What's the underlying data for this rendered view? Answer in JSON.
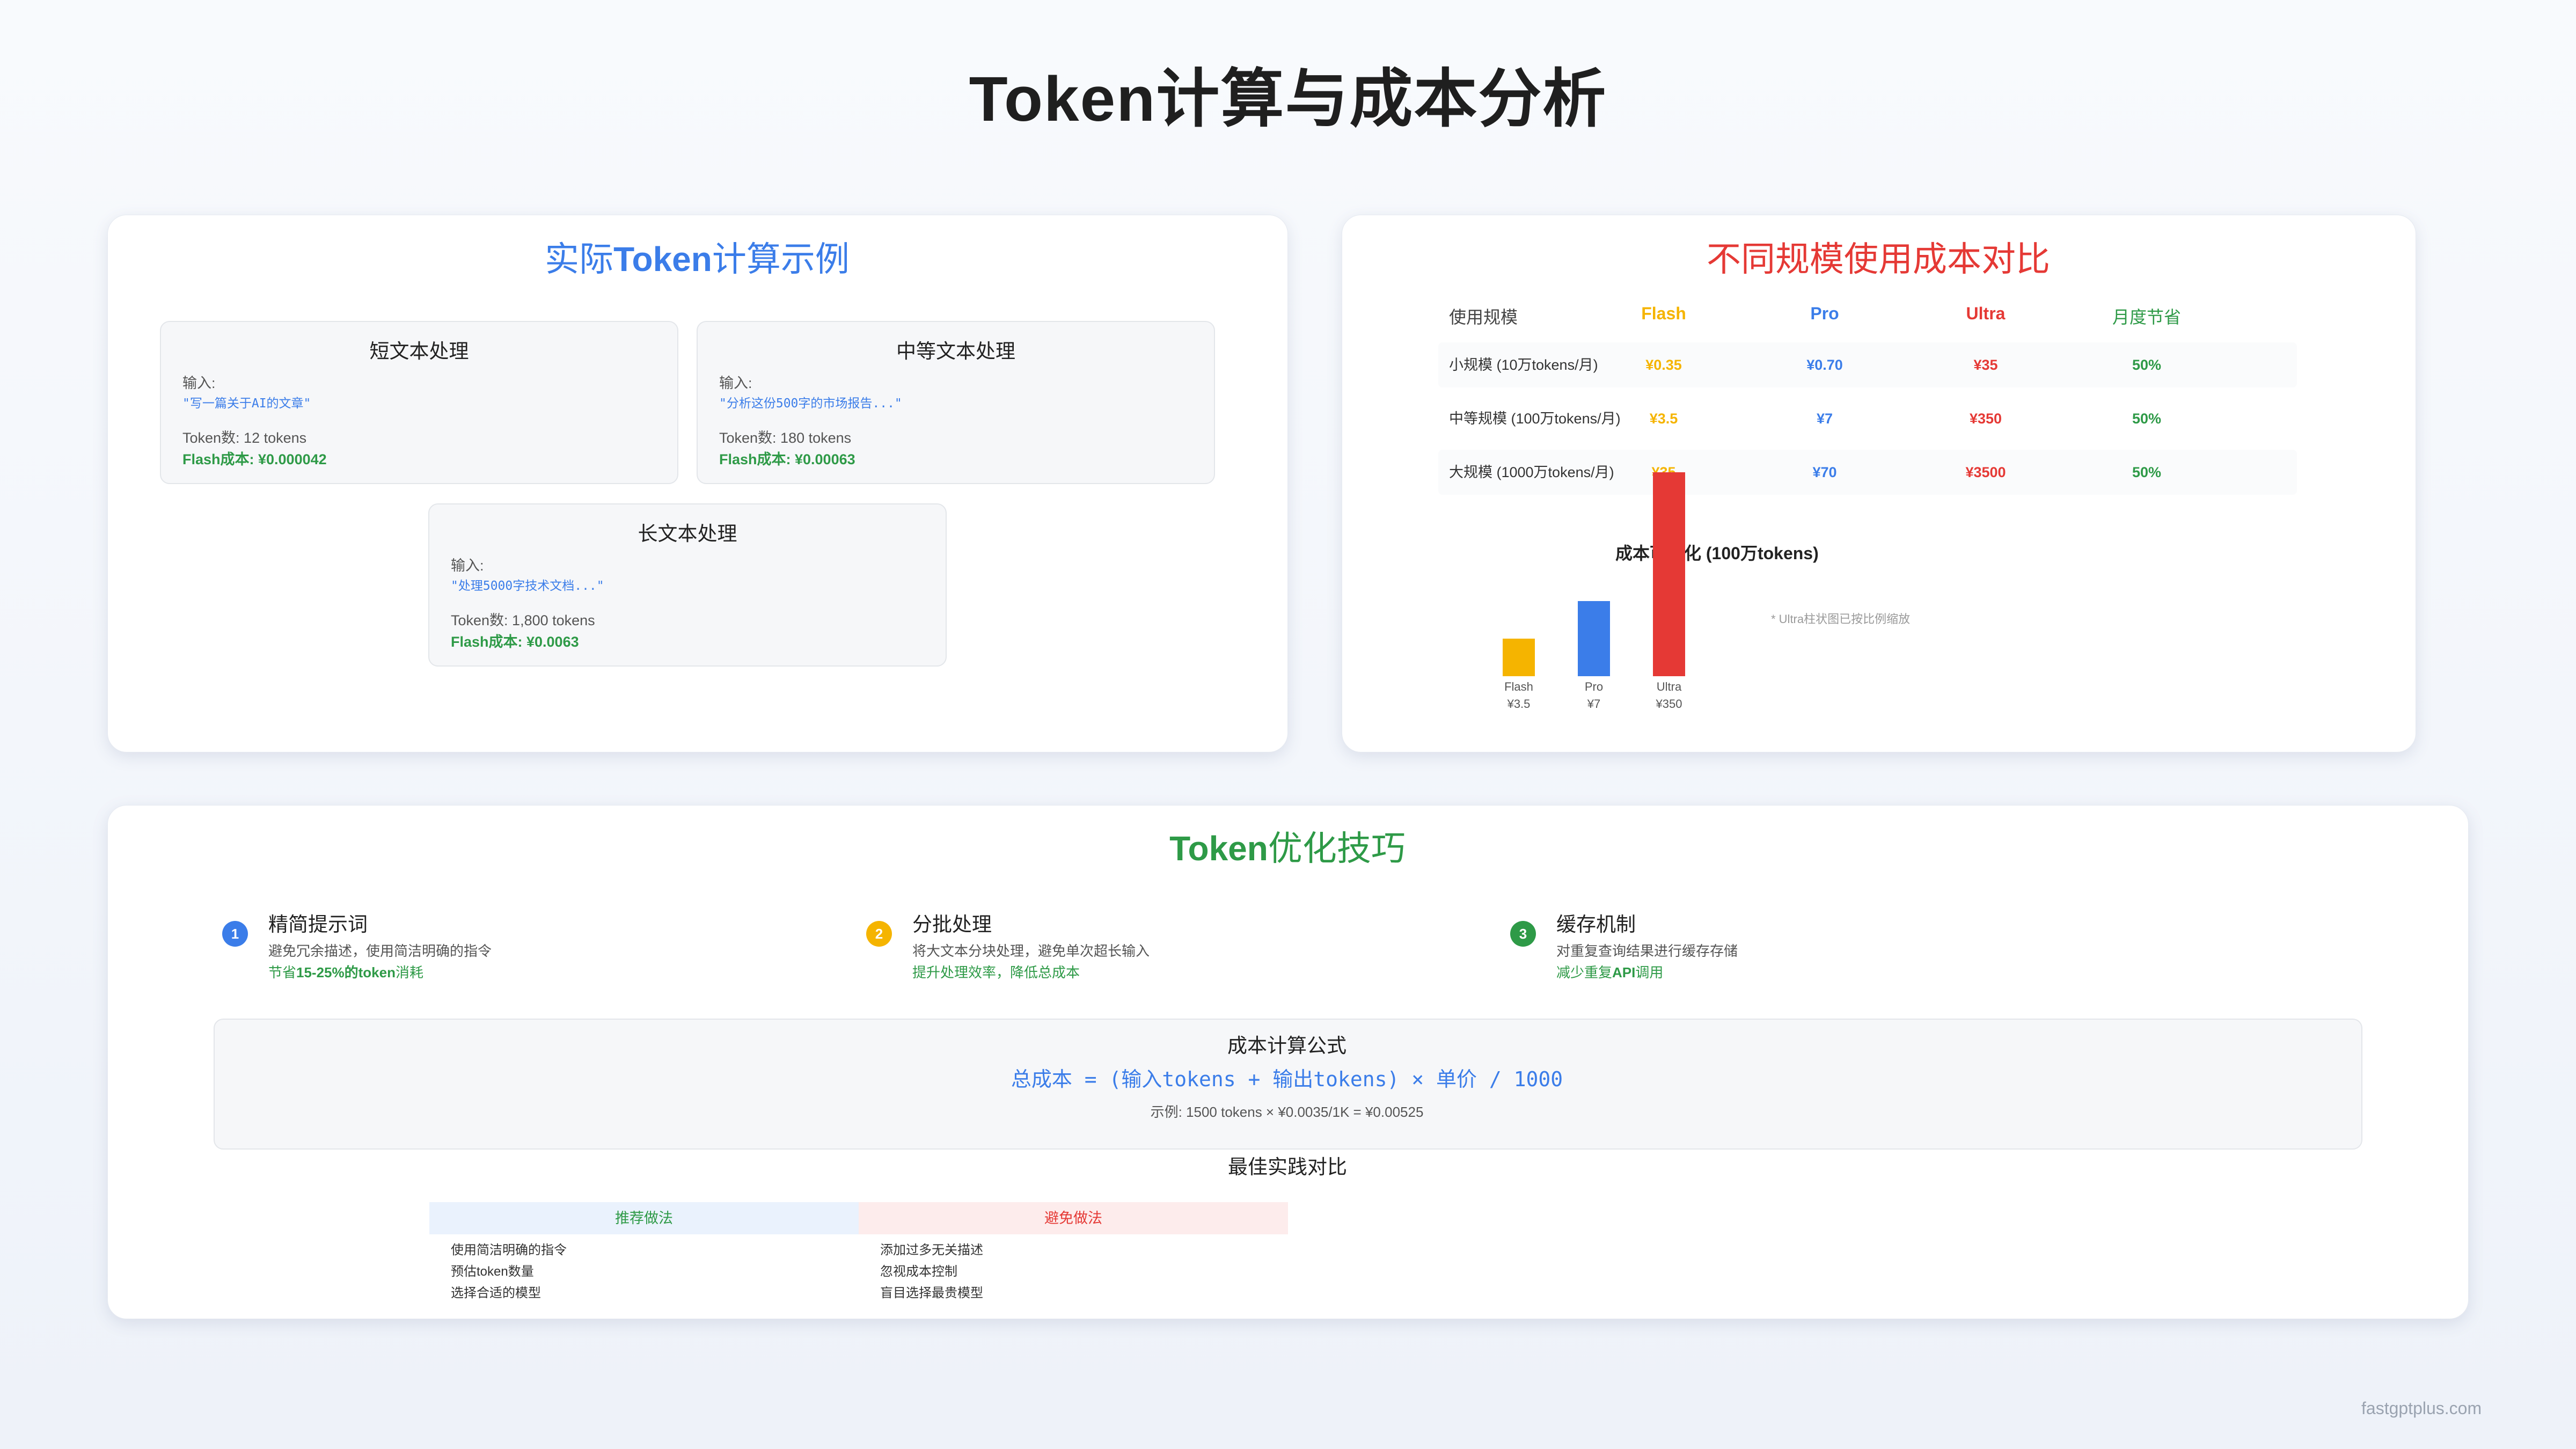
{
  "page_title": "Token计算与成本分析",
  "examples_card": {
    "title_prefix": "实际",
    "title_highlight": "Token",
    "title_suffix": "计算示例",
    "examples": [
      {
        "title": "短文本处理",
        "input_label": "输入:",
        "input_text": "\"写一篇关于AI的文章\"",
        "tokens": "Token数: 12 tokens",
        "cost": "Flash成本: ¥0.000042"
      },
      {
        "title": "中等文本处理",
        "input_label": "输入:",
        "input_text": "\"分析这份500字的市场报告...\"",
        "tokens": "Token数: 180 tokens",
        "cost": "Flash成本: ¥0.00063"
      },
      {
        "title": "长文本处理",
        "input_label": "输入:",
        "input_text": "\"处理5000字技术文档...\"",
        "tokens": "Token数: 1,800 tokens",
        "cost": "Flash成本: ¥0.0063"
      }
    ]
  },
  "cost_card": {
    "title": "不同规模使用成本对比",
    "headers": [
      "使用规模",
      "Flash",
      "Pro",
      "Ultra",
      "月度节省"
    ],
    "rows": [
      {
        "scale": "小规模 (10万tokens/月)",
        "flash": "¥0.35",
        "pro": "¥0.70",
        "ultra": "¥35",
        "saving": "50%"
      },
      {
        "scale": "中等规模 (100万tokens/月)",
        "flash": "¥3.5",
        "pro": "¥7",
        "ultra": "¥350",
        "saving": "50%"
      },
      {
        "scale": "大规模 (1000万tokens/月)",
        "flash": "¥35",
        "pro": "¥70",
        "ultra": "¥3500",
        "saving": "50%"
      }
    ],
    "chart_title": "成本可视化 (100万tokens)",
    "chart_note": "* Ultra柱状图已按比例缩放",
    "colors": {
      "flash": "#f5b400",
      "pro": "#3b7de9",
      "ultra": "#e53935",
      "saving": "#2e9a47"
    }
  },
  "chart_data": {
    "type": "bar",
    "title": "成本可视化 (100万tokens)",
    "categories": [
      "Flash",
      "Pro",
      "Ultra"
    ],
    "value_labels": [
      "¥3.5",
      "¥7",
      "¥350"
    ],
    "values": [
      3.5,
      7,
      350
    ],
    "note": "* Ultra柱状图已按比例缩放"
  },
  "tips_card": {
    "title_highlight": "Token",
    "title_suffix": "优化技巧",
    "tips": [
      {
        "num": "1",
        "title": "精简提示词",
        "desc": "避免冗余描述，使用简洁明确的指令",
        "save_prefix": "节省",
        "save_bold": "15-25%的token",
        "save_suffix": "消耗",
        "color": "#3b7de9"
      },
      {
        "num": "2",
        "title": "分批处理",
        "desc": "将大文本分块处理，避免单次超长输入",
        "save_prefix": "提升处理效率，降低总成本",
        "save_bold": "",
        "save_suffix": "",
        "color": "#f5b400"
      },
      {
        "num": "3",
        "title": "缓存机制",
        "desc": "对重复查询结果进行缓存存储",
        "save_prefix": "减少重复",
        "save_bold": "API",
        "save_suffix": "调用",
        "color": "#2e9a47"
      }
    ],
    "formula": {
      "title": "成本计算公式",
      "expression": "总成本 = (输入tokens + 输出tokens) × 单价 / 1000",
      "example": "示例: 1500 tokens × ¥0.0035/1K = ¥0.00525"
    },
    "best_practices": {
      "title": "最佳实践对比",
      "recommended_header": "推荐做法",
      "avoid_header": "避免做法",
      "recommended": [
        "使用简洁明确的指令",
        "预估token数量",
        "选择合适的模型"
      ],
      "avoid": [
        "添加过多无关描述",
        "忽视成本控制",
        "盲目选择最贵模型"
      ]
    }
  },
  "watermark": "fastgptplus.com"
}
